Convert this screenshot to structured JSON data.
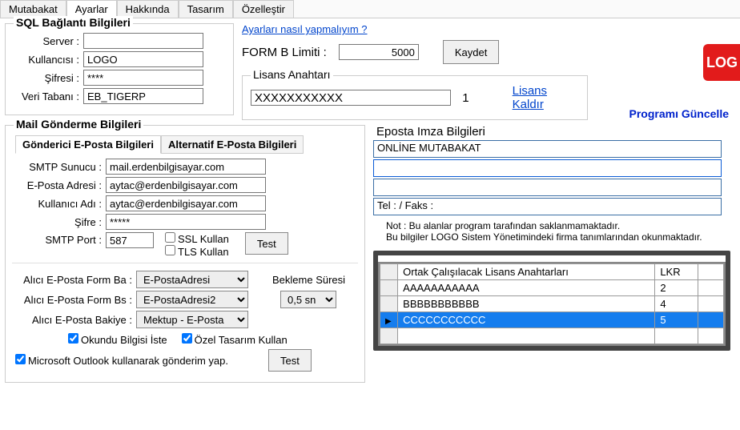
{
  "tabs": [
    "Mutabakat",
    "Ayarlar",
    "Hakkında",
    "Tasarım",
    "Özelleştir"
  ],
  "active_tab": "Ayarlar",
  "sql": {
    "title": "SQL Bağlantı Bilgileri",
    "server_label": "Server :",
    "server": "",
    "user_label": "Kullancısı :",
    "user": "LOGO",
    "pass_label": "Şifresi :",
    "pass": "****",
    "db_label": "Veri Tabanı :",
    "db": "EB_TIGERP"
  },
  "top": {
    "help_link": "Ayarları nasıl yapmalıyım ?",
    "formb_label": "FORM B Limiti :",
    "formb": "5000",
    "save_button": "Kaydet",
    "update": "Programı Güncelle"
  },
  "license": {
    "title": "Lisans Anahtarı",
    "key": "XXXXXXXXXXX",
    "count": "1",
    "remove": "Lisans Kaldır"
  },
  "mail": {
    "title": "Mail Gönderme Bilgileri",
    "subtabs": [
      "Gönderici E-Posta Bilgileri",
      "Alternatif E-Posta Bilgileri"
    ],
    "smtp_label": "SMTP Sunucu :",
    "smtp": "mail.erdenbilgisayar.com",
    "addr_label": "E-Posta Adresi :",
    "addr": "aytac@erdenbilgisayar.com",
    "username_label": "Kullanıcı Adı :",
    "username": "aytac@erdenbilgisayar.com",
    "password_label": "Şifre :",
    "password": "*****",
    "port_label": "SMTP Port :",
    "port": "587",
    "ssl_label": "SSL Kullan",
    "tls_label": "TLS Kullan",
    "test_button": "Test",
    "forma_label": "Alıcı E-Posta Form Ba :",
    "forma_sel": "E-PostaAdresi",
    "formb_label": "Alıcı E-Posta Form Bs :",
    "formb_sel": "E-PostaAdresi2",
    "bakiye_label": "Alıcı E-Posta Bakiye :",
    "bakiye_sel": "Mektup - E-Posta",
    "wait_label": "Bekleme Süresi",
    "wait_sel": "0,5 sn",
    "read_receipt": "Okundu Bilgisi İste",
    "custom_design": "Özel Tasarım Kullan",
    "outlook": "Microsoft Outlook kullanarak gönderim yap.",
    "test2": "Test"
  },
  "imza": {
    "title": "Eposta Imza Bilgileri",
    "line1": "ONLİNE MUTABAKAT",
    "line2": "",
    "line3": "",
    "line4": "Tel : / Faks :",
    "note1": "Not : Bu alanlar program tarafından saklanmamaktadır.",
    "note2": "Bu bilgiler LOGO Sistem Yönetimindeki firma tanımlarından okunmaktadır."
  },
  "grid": {
    "header1": "Ortak Çalışılacak Lisans Anahtarları",
    "header2": "LKR",
    "rows": [
      {
        "key": "AAAAAAAAAAA",
        "lkr": "2"
      },
      {
        "key": "BBBBBBBBBBB",
        "lkr": "4"
      },
      {
        "key": "CCCCCCCCCCC",
        "lkr": "5"
      },
      {
        "key": "",
        "lkr": ""
      }
    ],
    "selected_index": 2
  }
}
